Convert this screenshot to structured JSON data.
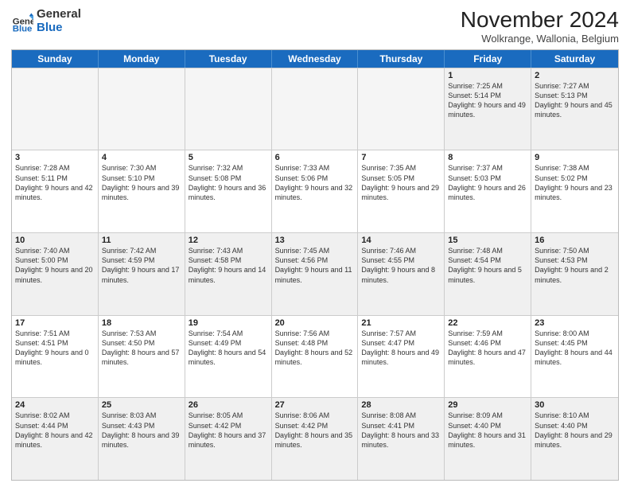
{
  "logo": {
    "general": "General",
    "blue": "Blue"
  },
  "header": {
    "month": "November 2024",
    "location": "Wolkrange, Wallonia, Belgium"
  },
  "days": [
    "Sunday",
    "Monday",
    "Tuesday",
    "Wednesday",
    "Thursday",
    "Friday",
    "Saturday"
  ],
  "weeks": [
    [
      {
        "day": "",
        "empty": true
      },
      {
        "day": "",
        "empty": true
      },
      {
        "day": "",
        "empty": true
      },
      {
        "day": "",
        "empty": true
      },
      {
        "day": "",
        "empty": true
      },
      {
        "day": "1",
        "rise": "7:25 AM",
        "set": "5:14 PM",
        "daylight": "9 hours and 49 minutes."
      },
      {
        "day": "2",
        "rise": "7:27 AM",
        "set": "5:13 PM",
        "daylight": "9 hours and 45 minutes."
      }
    ],
    [
      {
        "day": "3",
        "rise": "7:28 AM",
        "set": "5:11 PM",
        "daylight": "9 hours and 42 minutes."
      },
      {
        "day": "4",
        "rise": "7:30 AM",
        "set": "5:10 PM",
        "daylight": "9 hours and 39 minutes."
      },
      {
        "day": "5",
        "rise": "7:32 AM",
        "set": "5:08 PM",
        "daylight": "9 hours and 36 minutes."
      },
      {
        "day": "6",
        "rise": "7:33 AM",
        "set": "5:06 PM",
        "daylight": "9 hours and 32 minutes."
      },
      {
        "day": "7",
        "rise": "7:35 AM",
        "set": "5:05 PM",
        "daylight": "9 hours and 29 minutes."
      },
      {
        "day": "8",
        "rise": "7:37 AM",
        "set": "5:03 PM",
        "daylight": "9 hours and 26 minutes."
      },
      {
        "day": "9",
        "rise": "7:38 AM",
        "set": "5:02 PM",
        "daylight": "9 hours and 23 minutes."
      }
    ],
    [
      {
        "day": "10",
        "rise": "7:40 AM",
        "set": "5:00 PM",
        "daylight": "9 hours and 20 minutes."
      },
      {
        "day": "11",
        "rise": "7:42 AM",
        "set": "4:59 PM",
        "daylight": "9 hours and 17 minutes."
      },
      {
        "day": "12",
        "rise": "7:43 AM",
        "set": "4:58 PM",
        "daylight": "9 hours and 14 minutes."
      },
      {
        "day": "13",
        "rise": "7:45 AM",
        "set": "4:56 PM",
        "daylight": "9 hours and 11 minutes."
      },
      {
        "day": "14",
        "rise": "7:46 AM",
        "set": "4:55 PM",
        "daylight": "9 hours and 8 minutes."
      },
      {
        "day": "15",
        "rise": "7:48 AM",
        "set": "4:54 PM",
        "daylight": "9 hours and 5 minutes."
      },
      {
        "day": "16",
        "rise": "7:50 AM",
        "set": "4:53 PM",
        "daylight": "9 hours and 2 minutes."
      }
    ],
    [
      {
        "day": "17",
        "rise": "7:51 AM",
        "set": "4:51 PM",
        "daylight": "9 hours and 0 minutes."
      },
      {
        "day": "18",
        "rise": "7:53 AM",
        "set": "4:50 PM",
        "daylight": "8 hours and 57 minutes."
      },
      {
        "day": "19",
        "rise": "7:54 AM",
        "set": "4:49 PM",
        "daylight": "8 hours and 54 minutes."
      },
      {
        "day": "20",
        "rise": "7:56 AM",
        "set": "4:48 PM",
        "daylight": "8 hours and 52 minutes."
      },
      {
        "day": "21",
        "rise": "7:57 AM",
        "set": "4:47 PM",
        "daylight": "8 hours and 49 minutes."
      },
      {
        "day": "22",
        "rise": "7:59 AM",
        "set": "4:46 PM",
        "daylight": "8 hours and 47 minutes."
      },
      {
        "day": "23",
        "rise": "8:00 AM",
        "set": "4:45 PM",
        "daylight": "8 hours and 44 minutes."
      }
    ],
    [
      {
        "day": "24",
        "rise": "8:02 AM",
        "set": "4:44 PM",
        "daylight": "8 hours and 42 minutes."
      },
      {
        "day": "25",
        "rise": "8:03 AM",
        "set": "4:43 PM",
        "daylight": "8 hours and 39 minutes."
      },
      {
        "day": "26",
        "rise": "8:05 AM",
        "set": "4:42 PM",
        "daylight": "8 hours and 37 minutes."
      },
      {
        "day": "27",
        "rise": "8:06 AM",
        "set": "4:42 PM",
        "daylight": "8 hours and 35 minutes."
      },
      {
        "day": "28",
        "rise": "8:08 AM",
        "set": "4:41 PM",
        "daylight": "8 hours and 33 minutes."
      },
      {
        "day": "29",
        "rise": "8:09 AM",
        "set": "4:40 PM",
        "daylight": "8 hours and 31 minutes."
      },
      {
        "day": "30",
        "rise": "8:10 AM",
        "set": "4:40 PM",
        "daylight": "8 hours and 29 minutes."
      }
    ]
  ]
}
